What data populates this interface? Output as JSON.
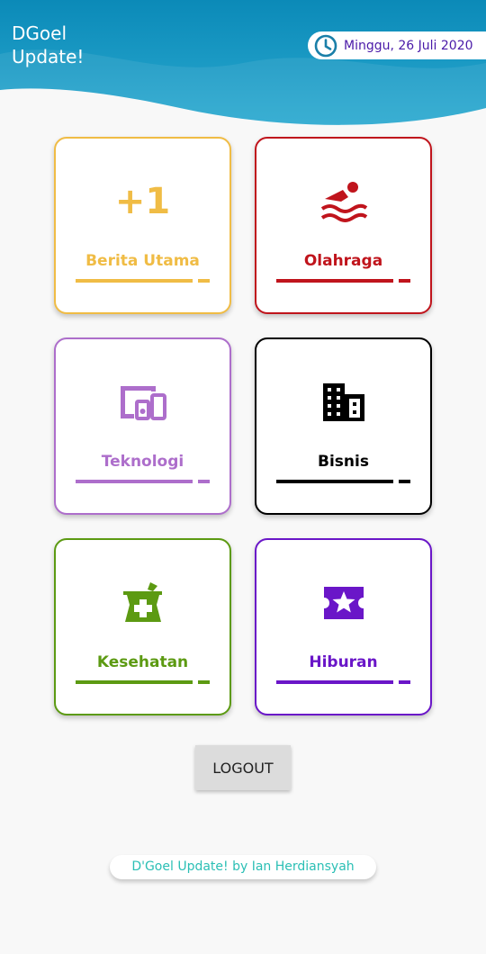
{
  "header": {
    "app_title": "DGoel\nUpdate!",
    "date": "Minggu, 26 Juli 2020",
    "icon": "clock-icon"
  },
  "categories": [
    {
      "label": "Berita Utama",
      "icon": "plus-one-icon",
      "icon_text": "+1",
      "color": "#f0bc45"
    },
    {
      "label": "Olahraga",
      "icon": "swimming-icon",
      "color": "#c0141c"
    },
    {
      "label": "Teknologi",
      "icon": "devices-icon",
      "color": "#ad6ecb"
    },
    {
      "label": "Bisnis",
      "icon": "building-icon",
      "color": "#000000"
    },
    {
      "label": "Kesehatan",
      "icon": "medicine-mortar-icon",
      "color": "#5c9a12"
    },
    {
      "label": "Hiburan",
      "icon": "ticket-star-icon",
      "color": "#6a16c8"
    }
  ],
  "logout": {
    "label": "LOGOUT"
  },
  "footer": {
    "credit": "D'Goel Update! by Ian Herdiansyah"
  },
  "colors": {
    "header_blue": "#1f9fc5",
    "date_text": "#4a1aa8",
    "footer_text": "#2bbfb5"
  }
}
